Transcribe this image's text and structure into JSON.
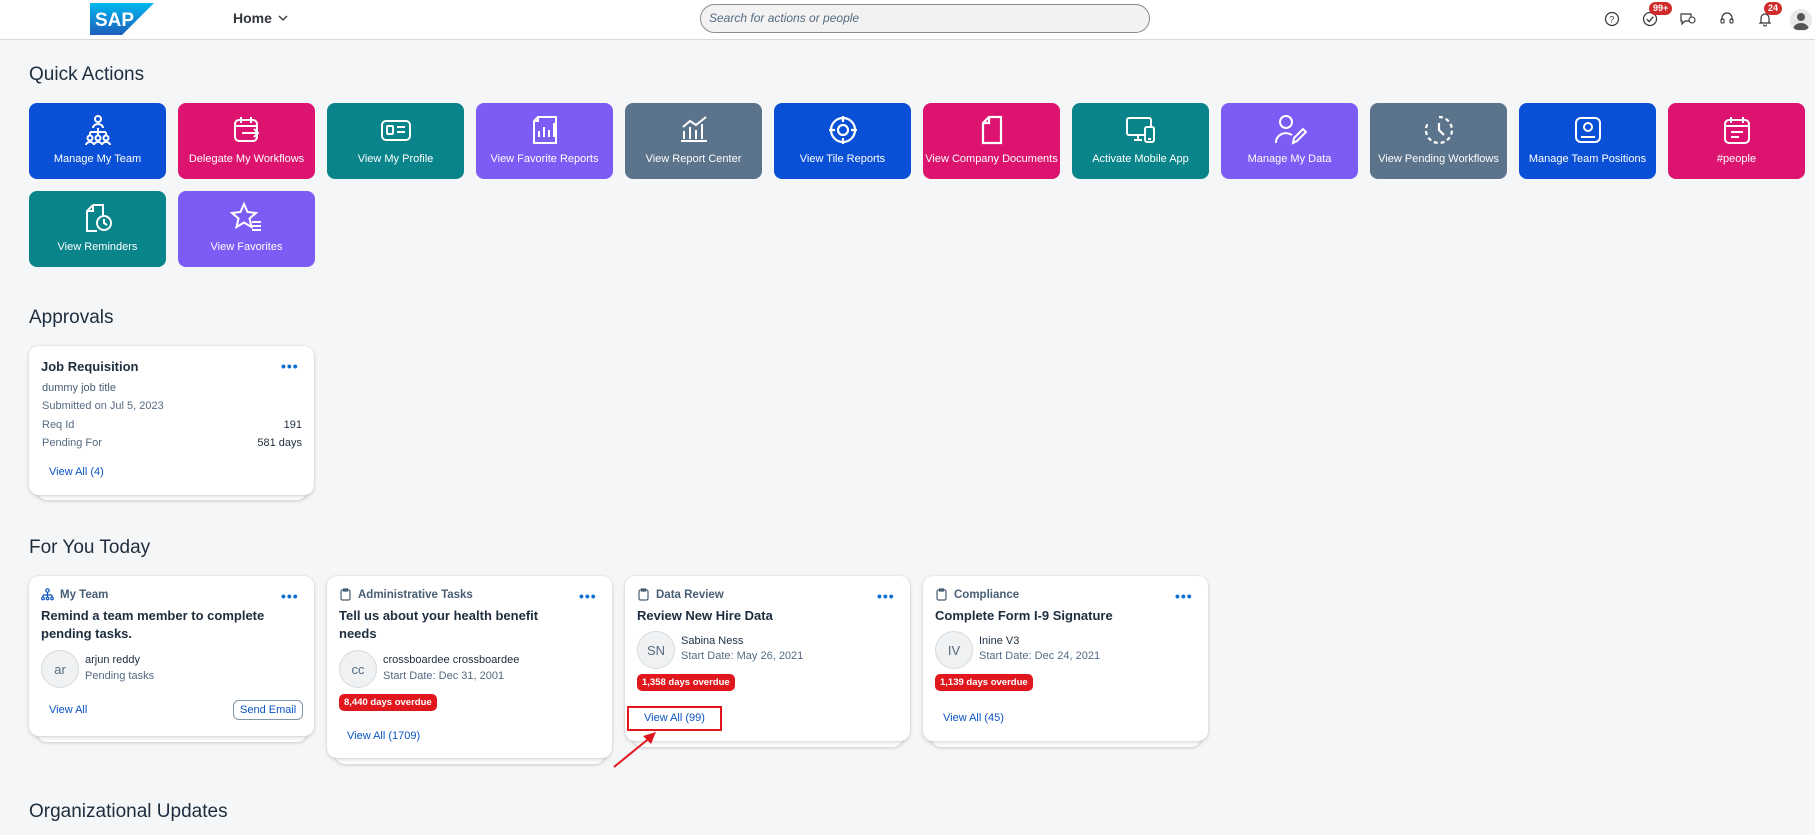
{
  "header": {
    "logo_text": "SAP",
    "home_label": "Home",
    "search_placeholder": "Search for actions or people",
    "tasks_badge": "99+",
    "notifications_badge": "24"
  },
  "quick_actions": {
    "title": "Quick Actions",
    "tiles": [
      {
        "label": "Manage My Team",
        "icon": "team-icon"
      },
      {
        "label": "Delegate My Workflows",
        "icon": "delegate-calendar-icon"
      },
      {
        "label": "View My Profile",
        "icon": "profile-card-icon"
      },
      {
        "label": "View Favorite Reports",
        "icon": "favorite-reports-icon"
      },
      {
        "label": "View Report Center",
        "icon": "report-chart-icon"
      },
      {
        "label": "View Tile Reports",
        "icon": "target-icon"
      },
      {
        "label": "View Company Documents",
        "icon": "document-icon"
      },
      {
        "label": "Activate Mobile App",
        "icon": "mobile-device-icon"
      },
      {
        "label": "Manage My Data",
        "icon": "edit-person-icon"
      },
      {
        "label": "View Pending Workflows",
        "icon": "pending-clock-icon"
      },
      {
        "label": "Manage Team Positions",
        "icon": "position-badge-icon"
      },
      {
        "label": "#people",
        "icon": "calendar-list-icon"
      },
      {
        "label": "View Reminders",
        "icon": "reminder-icon"
      },
      {
        "label": "View Favorites",
        "icon": "star-list-icon"
      }
    ]
  },
  "approvals": {
    "title": "Approvals",
    "card": {
      "title": "Job Requisition",
      "subtitle": "dummy job title",
      "submitted": "Submitted on Jul 5, 2023",
      "req_id_label": "Req Id",
      "req_id_value": "191",
      "pending_label": "Pending For",
      "pending_value": "581 days",
      "view_all": "View All (4)"
    }
  },
  "for_you_today": {
    "title": "For You Today",
    "cards": [
      {
        "category": "My Team",
        "title_line1": "Remind a team member to complete",
        "title_line2": "pending tasks.",
        "avatar": "ar",
        "person": "arjun reddy",
        "detail": "Pending tasks",
        "view_all": "View All",
        "button": "Send Email"
      },
      {
        "category": "Administrative Tasks",
        "title_line1": "Tell us about your health benefit",
        "title_line2": "needs",
        "avatar": "cc",
        "person": "crossboardee crossboardee",
        "detail": "Start Date: Dec 31, 2001",
        "overdue": "8,440 days overdue",
        "view_all": "View All (1709)"
      },
      {
        "category": "Data Review",
        "title_line1": "Review New Hire Data",
        "avatar": "SN",
        "person": "Sabina Ness",
        "detail": "Start Date: May 26, 2021",
        "overdue": "1,358 days overdue",
        "view_all": "View All (99)"
      },
      {
        "category": "Compliance",
        "title_line1": "Complete Form I-9 Signature",
        "avatar": "IV",
        "person": "Inine V3",
        "detail": "Start Date: Dec 24, 2021",
        "overdue": "1,139 days overdue",
        "view_all": "View All (45)"
      }
    ]
  },
  "org_updates": {
    "title": "Organizational Updates"
  }
}
